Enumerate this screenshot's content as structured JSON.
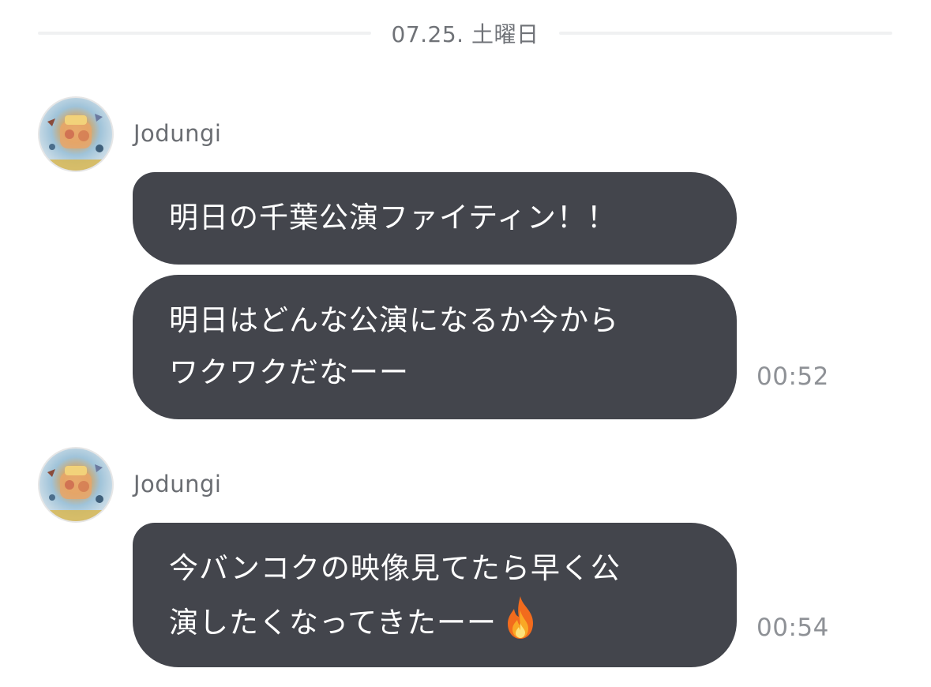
{
  "date_separator": "07.25. 土曜日",
  "groups": [
    {
      "sender": "Jodungi",
      "messages": [
        {
          "text": "明日の千葉公演ファイティン！！"
        },
        {
          "text_line1": "明日はどんな公演になるか今から",
          "text_line2": "ワクワクだなーー",
          "time": "00:52"
        }
      ]
    },
    {
      "sender": "Jodungi",
      "messages": [
        {
          "text_line1": "今バンコクの映像見てたら早く公",
          "text_line2": "演したくなってきたーー",
          "emoji": "fire-icon",
          "time": "00:54"
        }
      ]
    }
  ],
  "colors": {
    "bubble": "#43454c",
    "bubble_text": "#ffffff",
    "sender_text": "#6a6d72",
    "timestamp_text": "#8e9196",
    "separator_line": "#f0f1f2"
  }
}
